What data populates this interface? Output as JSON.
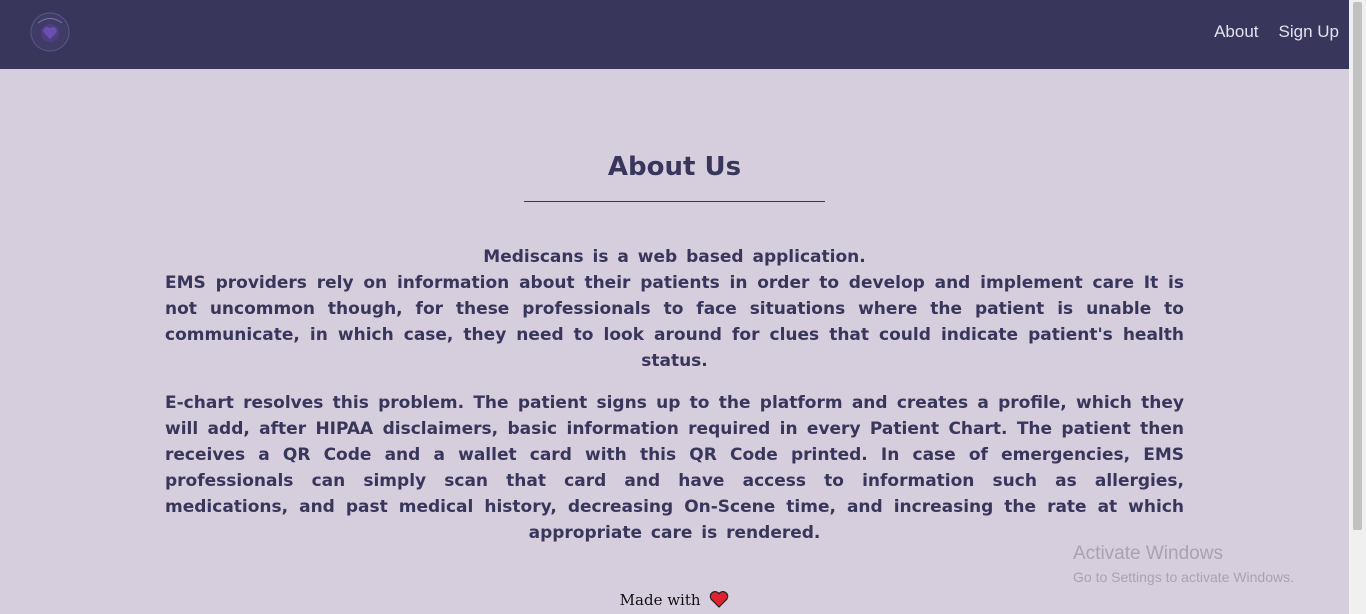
{
  "navbar": {
    "logo_icon": "mediscans-logo-icon",
    "links": [
      {
        "label": "About"
      },
      {
        "label": "Sign Up"
      }
    ]
  },
  "main": {
    "title": "About Us",
    "intro": "Mediscans is a web based application.",
    "paragraph1": "EMS providers rely on information about their patients in order to develop and implement care It is not uncommon though, for these professionals to face situations where the patient is unable to communicate, in which case, they need to look around for clues that could indicate patient's health status.",
    "paragraph2": "E-chart resolves this problem. The patient signs up to the platform and creates a profile, which they will add, after HIPAA disclaimers, basic information required in every Patient Chart. The patient then receives a QR Code and a wallet card with this QR Code printed. In case of emergencies, EMS professionals can simply scan that card and have access to information such as allergies, medications, and past medical history, decreasing On-Scene time, and increasing the rate at which appropriate care is rendered."
  },
  "footer": {
    "made_with": "Made with",
    "heart_icon": "heart-icon"
  },
  "watermark": {
    "title": "Activate Windows",
    "subtitle": "Go to Settings to activate Windows."
  },
  "colors": {
    "navbar_bg": "#39365c",
    "page_bg": "#d6cddd",
    "text": "#39365c",
    "heart": "#e0222e"
  }
}
